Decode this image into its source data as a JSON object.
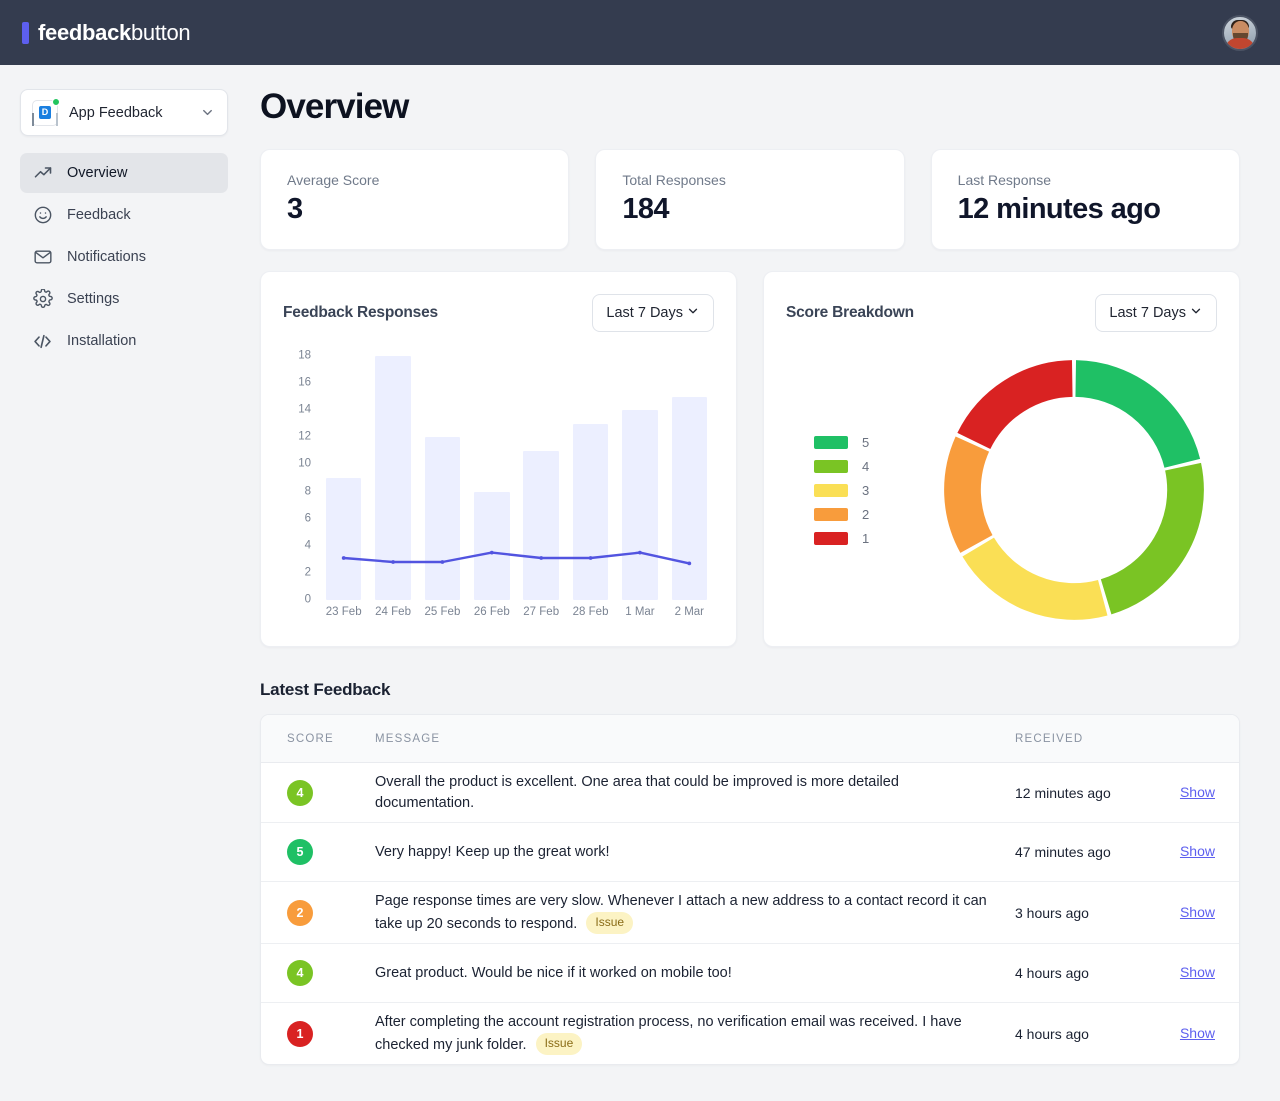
{
  "brand": {
    "name_bold": "feedback",
    "name_regular": "button",
    "accent": "#5d5fef",
    "topbar_bg": "#343c4f"
  },
  "header": {
    "avatar_alt": "user-avatar"
  },
  "sidebar": {
    "app_selector": {
      "label": "App Feedback",
      "icon": "app-document-icon",
      "icon_letter": "D",
      "status": "online",
      "chevron": "chevron-down-icon"
    },
    "items": [
      {
        "label": "Overview",
        "icon": "trending-up-icon",
        "active": true
      },
      {
        "label": "Feedback",
        "icon": "smiley-face-icon",
        "active": false
      },
      {
        "label": "Notifications",
        "icon": "envelope-icon",
        "active": false
      },
      {
        "label": "Settings",
        "icon": "gear-icon",
        "active": false
      },
      {
        "label": "Installation",
        "icon": "code-brackets-icon",
        "active": false
      }
    ]
  },
  "main": {
    "page_title": "Overview",
    "stats": [
      {
        "label": "Average Score",
        "value": "3"
      },
      {
        "label": "Total Responses",
        "value": "184"
      },
      {
        "label": "Last Response",
        "value": "12 minutes ago"
      }
    ],
    "range_label": "Last 7 Days",
    "latest_feedback_title": "Latest Feedback",
    "table": {
      "columns": [
        "SCORE",
        "MESSAGE",
        "RECEIVED",
        ""
      ],
      "action_label": "Show",
      "rows": [
        {
          "score": "4",
          "score_color": "#7ac424",
          "message": "Overall the product is excellent. One area that could be improved is more detailed documentation.",
          "tag": "",
          "received": "12 minutes ago"
        },
        {
          "score": "5",
          "score_color": "#1fc065",
          "message": "Very happy! Keep up the great work!",
          "tag": "",
          "received": "47 minutes ago"
        },
        {
          "score": "2",
          "score_color": "#f89c3c",
          "message": "Page response times are very slow. Whenever I attach a new address to a contact record it can take up 20 seconds to respond.",
          "tag": "Issue",
          "received": "3 hours ago"
        },
        {
          "score": "4",
          "score_color": "#7ac424",
          "message": "Great product. Would be nice if it worked on mobile too!",
          "tag": "",
          "received": "4 hours ago"
        },
        {
          "score": "1",
          "score_color": "#d92222",
          "message": "After completing the account registration process, no verification email was received. I have checked my junk folder.",
          "tag": "Issue",
          "received": "4 hours ago"
        }
      ]
    }
  },
  "chart_data": [
    {
      "type": "bar",
      "title": "Feedback Responses",
      "range": "Last 7 Days",
      "xlabel": "",
      "ylabel": "",
      "ylim": [
        0,
        18
      ],
      "yticks": [
        18,
        16,
        14,
        12,
        10,
        8,
        6,
        4,
        2,
        0
      ],
      "grid": false,
      "categories": [
        "23 Feb",
        "24 Feb",
        "25 Feb",
        "26 Feb",
        "27 Feb",
        "28 Feb",
        "1 Mar",
        "2 Mar"
      ],
      "series": [
        {
          "name": "Responses",
          "kind": "bar",
          "color": "#ecefff",
          "values": [
            9,
            18,
            12,
            8,
            11,
            13,
            14,
            15
          ]
        },
        {
          "name": "Average Score",
          "kind": "line",
          "color": "#5254e0",
          "values": [
            3.1,
            2.8,
            2.8,
            3.5,
            3.1,
            3.1,
            3.5,
            2.7
          ]
        }
      ]
    },
    {
      "type": "pie",
      "title": "Score Breakdown",
      "range": "Last 7 Days",
      "donut": true,
      "legend_position": "left",
      "labels": [
        "5",
        "4",
        "3",
        "2",
        "1"
      ],
      "colors": [
        "#1fc065",
        "#7ac424",
        "#fadf55",
        "#f89c3c",
        "#d92222"
      ],
      "values": [
        21.4,
        24.2,
        21.1,
        15.3,
        18.0
      ],
      "start_angle_deg": 0
    }
  ]
}
